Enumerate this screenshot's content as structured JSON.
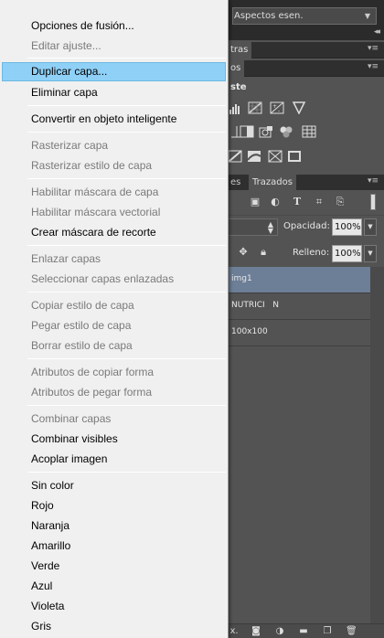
{
  "menu": {
    "items": [
      {
        "label": "Opciones de fusión...",
        "enabled": true
      },
      {
        "label": "Editar ajuste...",
        "enabled": false
      },
      {
        "label": "Duplicar capa...",
        "enabled": true,
        "highlighted": true
      },
      {
        "label": "Eliminar capa",
        "enabled": true
      },
      {
        "label": "Convertir en objeto inteligente",
        "enabled": true
      },
      {
        "label": "Rasterizar capa",
        "enabled": false
      },
      {
        "label": "Rasterizar estilo de capa",
        "enabled": false
      },
      {
        "label": "Habilitar máscara de capa",
        "enabled": false
      },
      {
        "label": "Habilitar máscara vectorial",
        "enabled": false
      },
      {
        "label": "Crear máscara de recorte",
        "enabled": true
      },
      {
        "label": "Enlazar capas",
        "enabled": false
      },
      {
        "label": "Seleccionar capas enlazadas",
        "enabled": false
      },
      {
        "label": "Copiar estilo de capa",
        "enabled": false
      },
      {
        "label": "Pegar estilo de capa",
        "enabled": false
      },
      {
        "label": "Borrar estilo de capa",
        "enabled": false
      },
      {
        "label": "Atributos de copiar forma",
        "enabled": false
      },
      {
        "label": "Atributos de pegar forma",
        "enabled": false
      },
      {
        "label": "Combinar capas",
        "enabled": false
      },
      {
        "label": "Combinar visibles",
        "enabled": true
      },
      {
        "label": "Acoplar imagen",
        "enabled": true
      },
      {
        "label": "Sin color",
        "enabled": true
      },
      {
        "label": "Rojo",
        "enabled": true
      },
      {
        "label": "Naranja",
        "enabled": true
      },
      {
        "label": "Amarillo",
        "enabled": true
      },
      {
        "label": "Verde",
        "enabled": true
      },
      {
        "label": "Azul",
        "enabled": true
      },
      {
        "label": "Violeta",
        "enabled": true
      },
      {
        "label": "Gris",
        "enabled": true
      }
    ]
  },
  "workspace": {
    "label": "Aspectos esen."
  },
  "panels": {
    "tab_partial_1": "tras",
    "tab_partial_2": "os",
    "ajustes_title": "ste",
    "layers_tab_partial": "es",
    "layers_tab_trazados": "Trazados",
    "opacity_label": "Opacidad:",
    "opacity_value": "100%",
    "fill_label": "Relleno:",
    "fill_value": "100%"
  },
  "layers": [
    {
      "name": "img1",
      "selected": true
    },
    {
      "name": "NUTRICI   N",
      "selected": false
    },
    {
      "name": "100x100",
      "selected": false
    }
  ],
  "colors": {
    "menu_bg": "#f0f0f0",
    "menu_highlight": "#8fd0f7",
    "disabled_text": "#7a7a7a",
    "panel_bg": "#535353",
    "selected_layer": "#6d7e97"
  }
}
